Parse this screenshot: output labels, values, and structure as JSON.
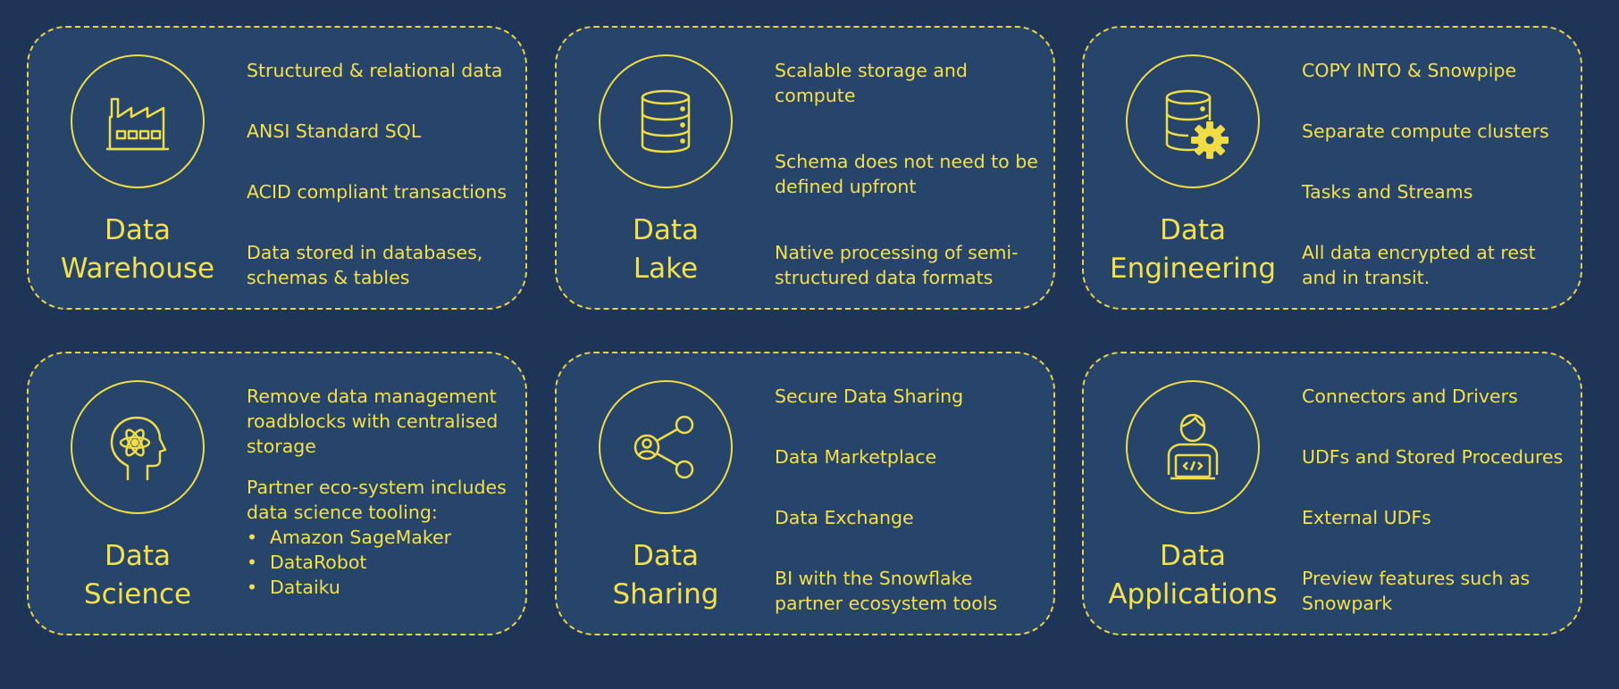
{
  "colors": {
    "background": "#1f3557",
    "card": "#27456a",
    "accent": "#f3e04a"
  },
  "cards": [
    {
      "title": [
        "Data",
        "Warehouse"
      ],
      "icon": "factory-icon",
      "items": [
        "Structured & relational data",
        "ANSI Standard SQL",
        "ACID compliant transactions",
        "Data stored in databases, schemas & tables"
      ]
    },
    {
      "title": [
        "Data",
        "Lake"
      ],
      "icon": "database-icon",
      "items": [
        "Scalable storage and compute",
        "Schema does not need to be defined upfront",
        "Native processing of semi-structured data formats"
      ]
    },
    {
      "title": [
        "Data",
        "Engineering"
      ],
      "icon": "database-gear-icon",
      "items": [
        "COPY INTO & Snowpipe",
        "Separate compute clusters",
        "Tasks and Streams",
        "All data encrypted at rest and in transit."
      ]
    },
    {
      "title": [
        "Data",
        "Science"
      ],
      "icon": "atom-head-icon",
      "items": [
        "Remove data management roadblocks with centralised storage",
        "Partner eco-system includes data science tooling:"
      ],
      "bullets": [
        "Amazon SageMaker",
        "DataRobot",
        "Dataiku"
      ]
    },
    {
      "title": [
        "Data",
        "Sharing"
      ],
      "icon": "share-icon",
      "items": [
        "Secure Data Sharing",
        "Data Marketplace",
        "Data Exchange",
        "BI with the Snowflake partner ecosystem tools"
      ]
    },
    {
      "title": [
        "Data",
        "Applications"
      ],
      "icon": "developer-icon",
      "items": [
        "Connectors and Drivers",
        "UDFs and Stored Procedures",
        "External UDFs",
        "Preview features such as Snowpark"
      ]
    }
  ]
}
